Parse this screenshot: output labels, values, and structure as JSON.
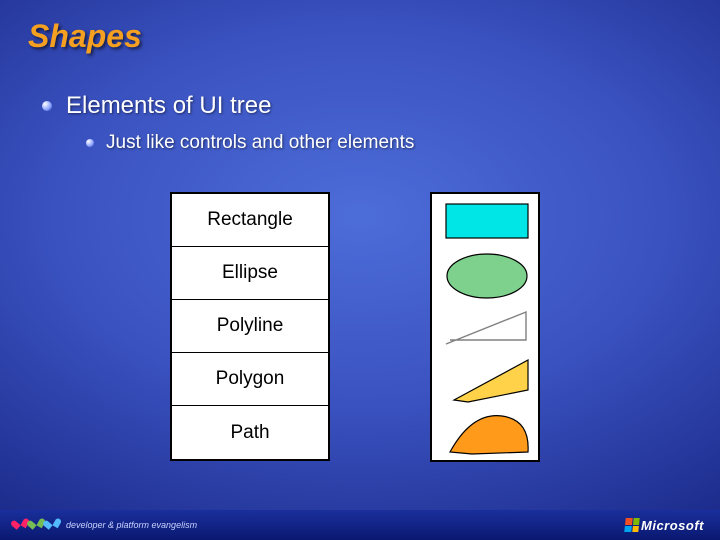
{
  "title": "Shapes",
  "bullets": {
    "lvl1": "Elements of UI tree",
    "lvl2": "Just like controls and other elements"
  },
  "shapes": [
    "Rectangle",
    "Ellipse",
    "Polyline",
    "Polygon",
    "Path"
  ],
  "footer": {
    "left_text": "developer & platform evangelism",
    "right_text": "Microsoft"
  },
  "colors": {
    "rectangle_fill": "#00e5e5",
    "ellipse_fill": "#7ed18d",
    "polyline_stroke": "#808080",
    "polygon_fill": "#ffd24a",
    "path_fill": "#ff9a1a"
  }
}
